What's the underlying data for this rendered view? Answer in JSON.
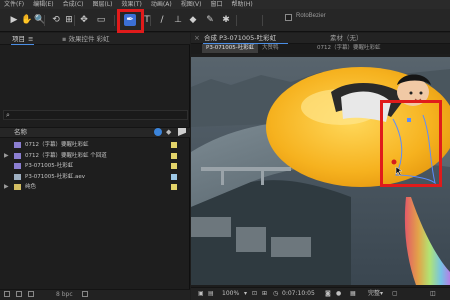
{
  "menubar": [
    "文件(F)",
    "编辑(E)",
    "合成(C)",
    "图层(L)",
    "效果(T)",
    "动画(A)",
    "视图(V)",
    "窗口",
    "帮助(H)"
  ],
  "toolbar": {
    "roto_label": "RotoBezier",
    "tools": [
      {
        "name": "selection-tool-icon",
        "glyph": "▶"
      },
      {
        "name": "hand-tool-icon",
        "glyph": "✋"
      },
      {
        "name": "zoom-tool-icon",
        "glyph": "🔍"
      },
      {
        "name": "rotate-tool-icon",
        "glyph": "⟲"
      },
      {
        "name": "camera-tool-icon",
        "glyph": "⊞"
      },
      {
        "name": "pan-behind-tool-icon",
        "glyph": "✥"
      },
      {
        "name": "rectangle-tool-icon",
        "glyph": "▭"
      },
      {
        "name": "pen-tool-icon",
        "glyph": "✒"
      },
      {
        "name": "type-tool-icon",
        "glyph": "T"
      },
      {
        "name": "brush-tool-icon",
        "glyph": "/"
      },
      {
        "name": "clone-stamp-tool-icon",
        "glyph": "⊥"
      },
      {
        "name": "eraser-tool-icon",
        "glyph": "◆"
      },
      {
        "name": "roto-brush-tool-icon",
        "glyph": "✎"
      },
      {
        "name": "puppet-tool-icon",
        "glyph": "✱"
      }
    ]
  },
  "project": {
    "tab_project": "项目",
    "tab_effects": "效果控件 彩虹",
    "col_name": "名称",
    "items": [
      {
        "arrow": "",
        "text": "0712（字幕）要醒吐彩虹",
        "icon_color": "#8b7ed1",
        "label_color": "#e3d46a"
      },
      {
        "arrow": "▶",
        "text": "0712（字幕）要醒吐彩虹 个回道",
        "icon_color": "#8b7ed1",
        "label_color": "#e3d46a"
      },
      {
        "arrow": "",
        "text": "P3-071005-吐彩虹",
        "icon_color": "#8b7ed1",
        "label_color": "#e3d46a"
      },
      {
        "arrow": "",
        "text": "P3-071005-吐彩虹.aev",
        "icon_color": "#9fb0c2",
        "label_color": "#9dc8e6"
      },
      {
        "arrow": "▶",
        "text": "纯色",
        "icon_color": "#d2bd62",
        "label_color": "#e3d46a"
      }
    ],
    "bpc": "8 bpc"
  },
  "comp": {
    "tab_label": "合成 P3-071005-吐彩虹",
    "footage_label": "素材（无）",
    "breadcrumbs": [
      {
        "text": "P3-071005-吐彩虹",
        "active": true
      },
      {
        "text": "大赞鸭",
        "active": false
      },
      {
        "text": "0712（字幕）要醒吐彩虹",
        "active": false
      }
    ],
    "zoom": "100%",
    "timecode": "0:07:10:05",
    "quality": "完整"
  }
}
